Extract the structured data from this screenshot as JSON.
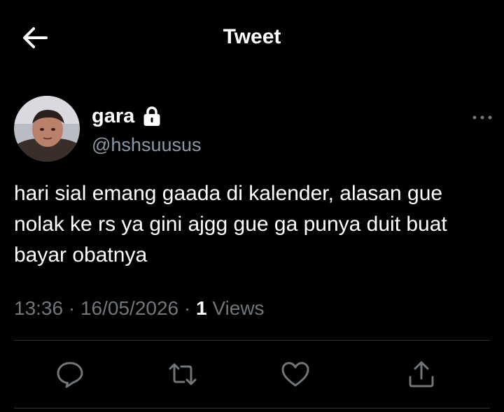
{
  "header": {
    "title": "Tweet",
    "back_icon": "arrow-left-icon"
  },
  "author": {
    "display_name": "gara",
    "protected_icon": "lock-icon",
    "handle": "@hshsuusus"
  },
  "more_icon": "more-horizontal-icon",
  "tweet": {
    "text": "hari sial emang gaada di kalender, alasan gue nolak ke rs ya gini ajgg gue ga punya duit buat bayar obatnya"
  },
  "meta": {
    "time": "13:36",
    "date": "16/05/2026",
    "separator": "·",
    "views_count": "1",
    "views_label": "Views"
  },
  "actions": {
    "icons": [
      "reply-icon",
      "retweet-icon",
      "like-icon",
      "share-icon"
    ]
  },
  "colors": {
    "background": "#000000",
    "primary_text": "#ffffff",
    "secondary_text": "#71767b",
    "divider": "#2f3336"
  }
}
